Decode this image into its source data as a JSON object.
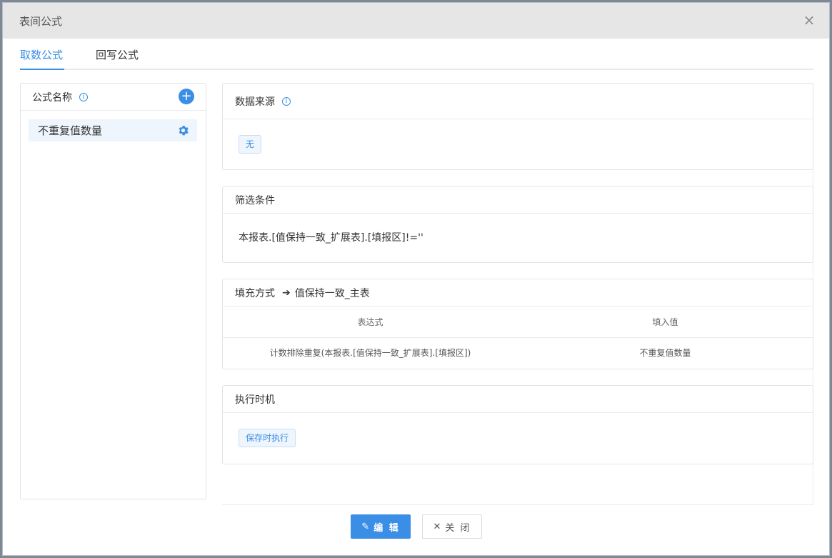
{
  "dialog": {
    "title": "表间公式",
    "close_icon": "close-icon"
  },
  "tabs": [
    {
      "label": "取数公式",
      "active": true
    },
    {
      "label": "回写公式",
      "active": false
    }
  ],
  "formula_list": {
    "header": "公式名称",
    "info_icon": "info-icon",
    "add_icon": "plus-circle-icon",
    "items": [
      {
        "label": "不重复值数量",
        "settings_icon": "gear-icon"
      }
    ]
  },
  "data_source": {
    "header": "数据来源",
    "info_icon": "info-icon",
    "tag": "无"
  },
  "filter": {
    "header": "筛选条件",
    "text": "本报表.[值保持一致_扩展表].[填报区]!=''"
  },
  "fill_mode": {
    "header": "填充方式",
    "arrow": "➔",
    "target": "值保持一致_主表",
    "columns": [
      "表达式",
      "填入值"
    ],
    "rows": [
      [
        "计数排除重复(本报表.[值保持一致_扩展表].[填报区])",
        "不重复值数量"
      ]
    ]
  },
  "timing": {
    "header": "执行时机",
    "tag": "保存时执行"
  },
  "footer": {
    "edit_label": "编 辑",
    "edit_icon": "edit-pencil-icon",
    "close_label": "关 闭",
    "close_icon": "close-icon"
  },
  "colors": {
    "accent": "#3a8ee6",
    "titlebar": "#e6e6e6"
  }
}
